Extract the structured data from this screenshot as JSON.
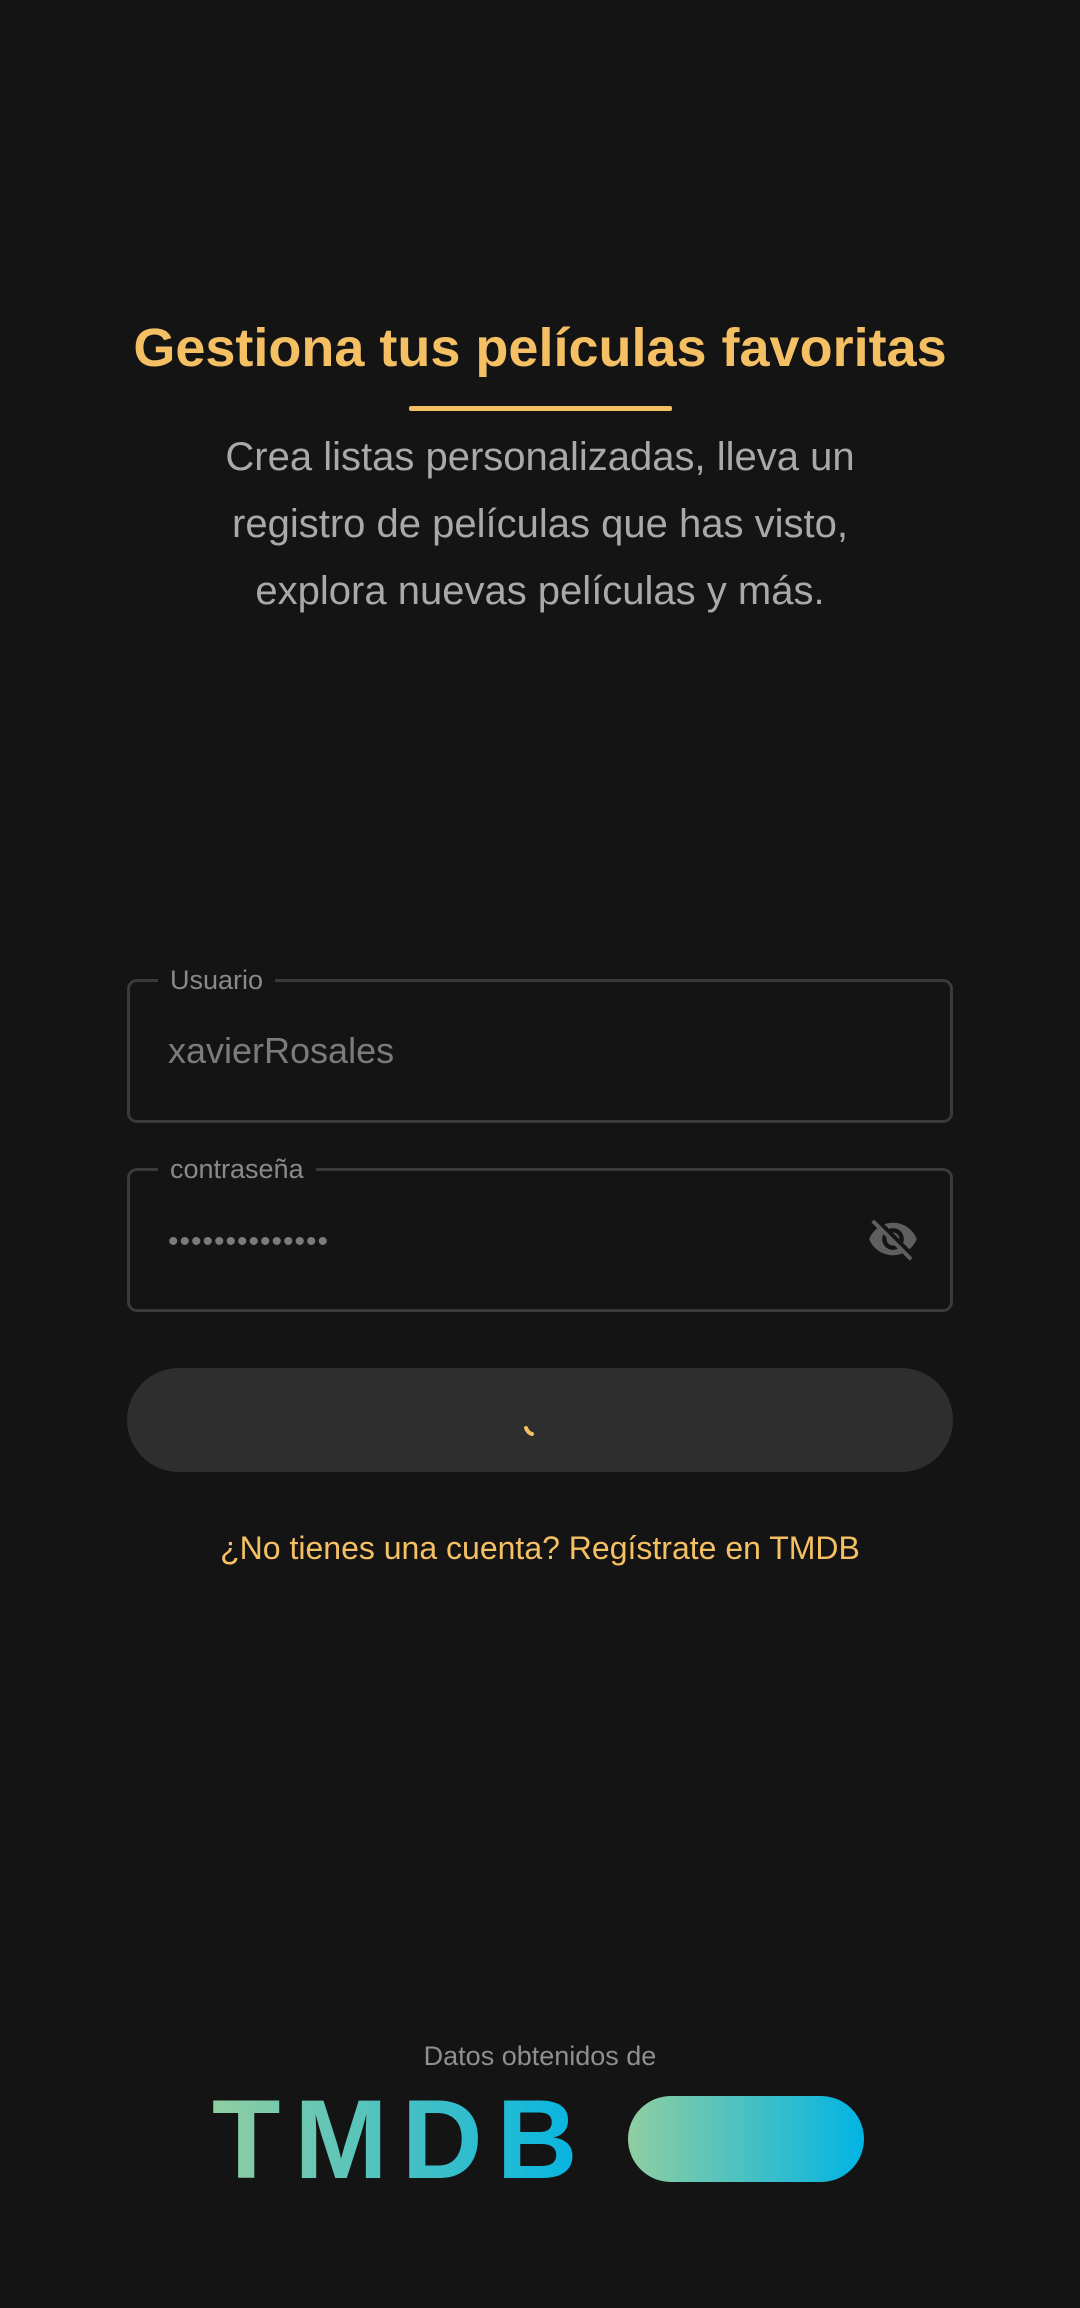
{
  "intro": {
    "title": "Gestiona tus películas favoritas",
    "subtitle": "Crea listas personalizadas, lleva un registro de películas que has visto, explora nuevas películas y más."
  },
  "form": {
    "username": {
      "label": "Usuario",
      "value": "xavierRosales"
    },
    "password": {
      "label": "contraseña",
      "value": "••••••••••••••",
      "toggle_icon": "visibility-off-icon"
    },
    "login_button": {
      "state": "loading"
    },
    "register_link": "¿No tienes una cuenta? Regístrate en TMDB"
  },
  "footer": {
    "credit": "Datos obtenidos de",
    "logo_text": "TMDB"
  },
  "colors": {
    "background": "#141414",
    "accent": "#f5c063",
    "tmdb_gradient_start": "#90cea1",
    "tmdb_gradient_end": "#01b4e4"
  }
}
